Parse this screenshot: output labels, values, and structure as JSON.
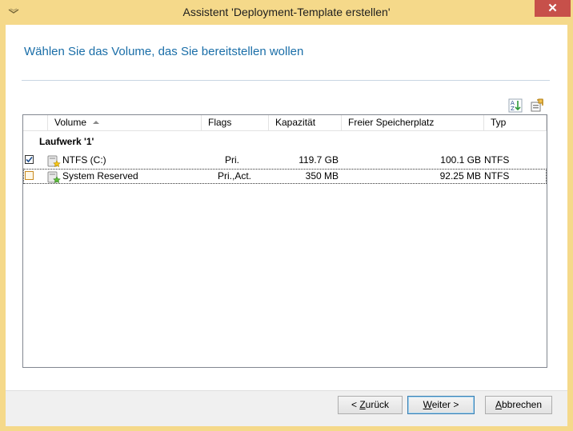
{
  "window": {
    "title": "Assistent 'Deployment-Template erstellen'",
    "close_label": "✕"
  },
  "page": {
    "heading": "Wählen Sie das Volume, das Sie bereitstellen wollen"
  },
  "columns": [
    {
      "label": "Volume",
      "sorted": "ascending"
    },
    {
      "label": "Flags"
    },
    {
      "label": "Kapazität"
    },
    {
      "label": "Freier Speicherplatz"
    },
    {
      "label": "Typ"
    }
  ],
  "group": {
    "label": "Laufwerk '1'"
  },
  "rows": [
    {
      "checked": true,
      "volume": "NTFS (C:)",
      "flags": "Pri.",
      "capacity": "119.7 GB",
      "free": "100.1 GB",
      "type": "NTFS"
    },
    {
      "checked": false,
      "volume": "System Reserved",
      "flags": "Pri.,Act.",
      "capacity": "350 MB",
      "free": "92.25 MB",
      "type": "NTFS",
      "selected": true
    }
  ],
  "buttons": {
    "back": {
      "prefix": "< ",
      "mnemonic": "Z",
      "rest": "urück"
    },
    "next": {
      "mnemonic": "W",
      "rest": "eiter >"
    },
    "cancel": {
      "mnemonic": "A",
      "rest": "bbrechen"
    }
  },
  "icons": {
    "sort_az": "sort-az-icon",
    "properties": "properties-icon",
    "volume": "drive-volume-icon"
  },
  "colors": {
    "titlebar": "#f5d98a",
    "heading": "#1a6ea8",
    "close": "#c7504a"
  }
}
